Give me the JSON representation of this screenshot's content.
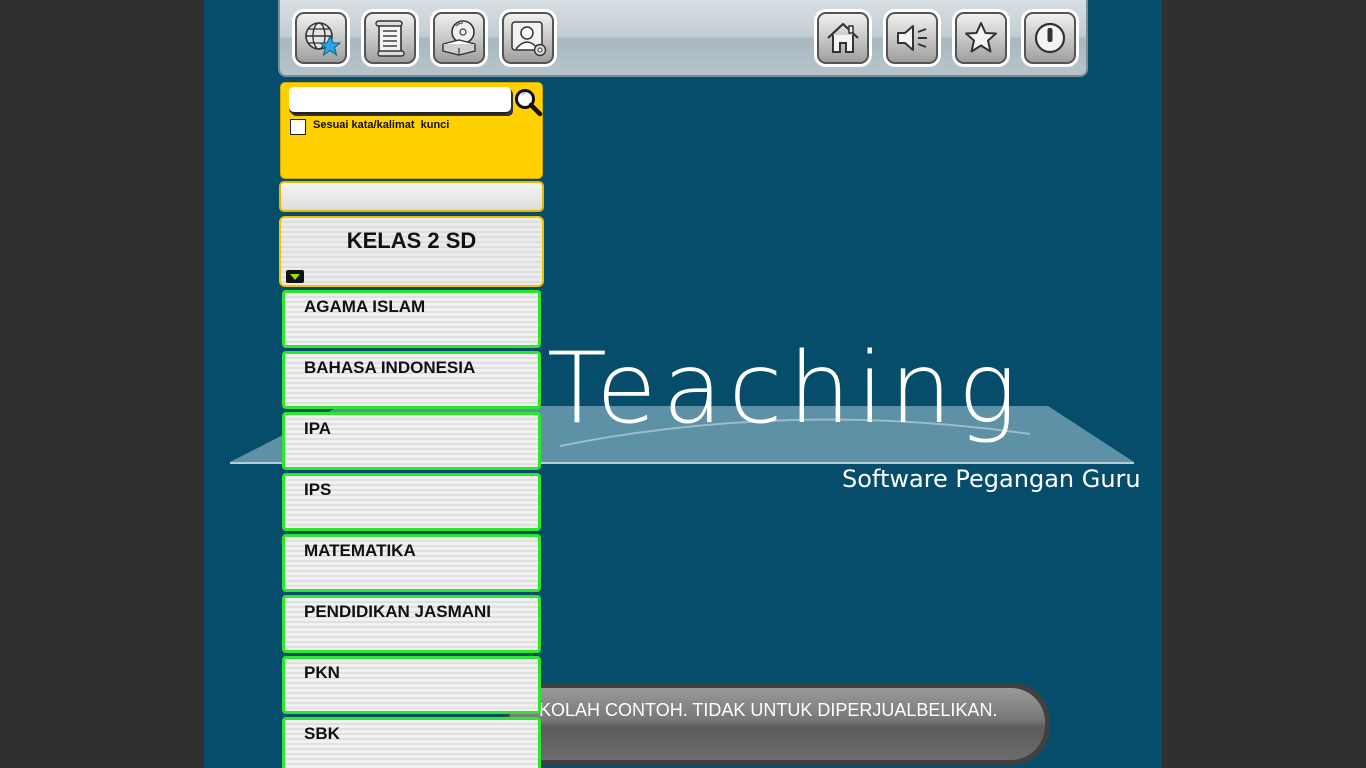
{
  "toolbar": {
    "left_buttons": [
      {
        "name": "globe-star-button",
        "icon": "globe-star-icon"
      },
      {
        "name": "scroll-document-button",
        "icon": "scroll-document-icon"
      },
      {
        "name": "disc-book-button",
        "icon": "disc-book-icon"
      },
      {
        "name": "user-settings-button",
        "icon": "user-settings-icon"
      }
    ],
    "right_buttons": [
      {
        "name": "home-button",
        "icon": "home-icon"
      },
      {
        "name": "sound-button",
        "icon": "speaker-icon"
      },
      {
        "name": "favorite-button",
        "icon": "star-icon"
      },
      {
        "name": "power-button",
        "icon": "power-icon"
      }
    ]
  },
  "search": {
    "value": "",
    "checkbox_label": "Sesuai kata/kalimat  kunci",
    "checked": false
  },
  "class_selector": {
    "label": "KELAS 2 SD"
  },
  "subjects": [
    "AGAMA ISLAM",
    "BAHASA INDONESIA",
    "IPA",
    "IPS",
    "MATEMATIKA",
    "PENDIDIKAN JASMANI",
    "PKN",
    "SBK"
  ],
  "logo": {
    "title": "Teaching",
    "subtitle": "Software Pegangan Guru"
  },
  "marquee": {
    "text": "KOLAH CONTOH. TIDAK UNTUK DIPERJUALBELIKAN."
  },
  "colors": {
    "background": "#064d6c",
    "search_panel": "#ffd100",
    "subject_border": "#2ce82c"
  }
}
